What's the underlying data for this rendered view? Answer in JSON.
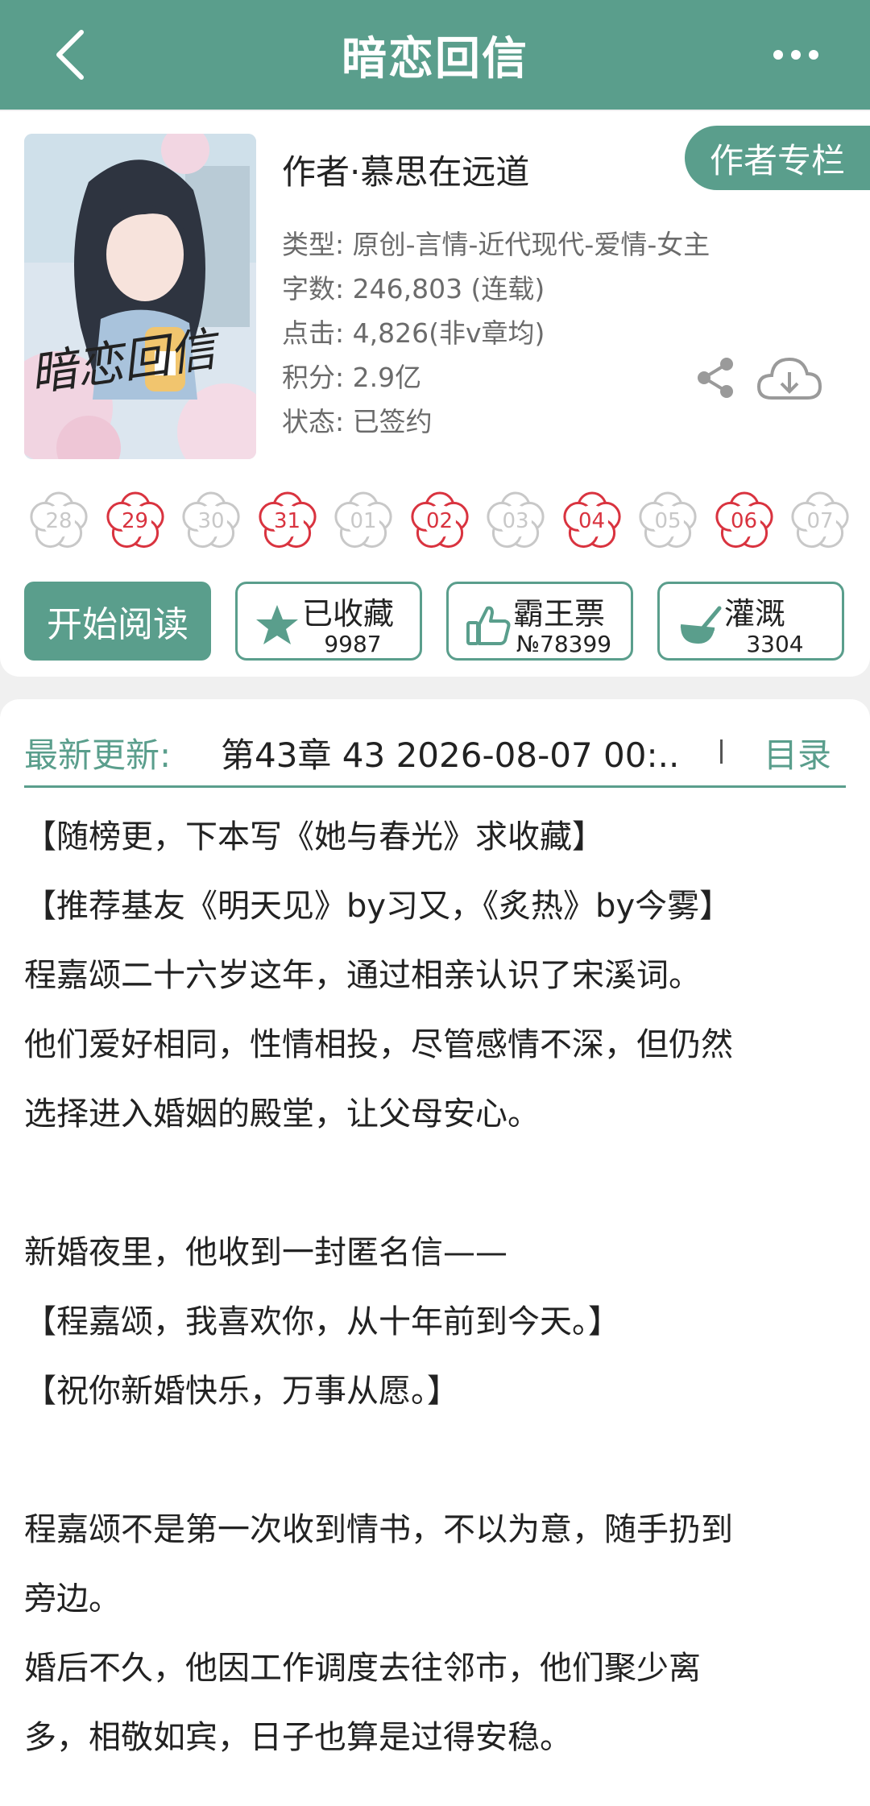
{
  "header": {
    "title": "暗恋回信"
  },
  "book": {
    "author": "作者·慕思在远道",
    "author_column_label": "作者专栏",
    "cover_title_art": "暗恋回信",
    "meta": [
      "类型: 原创-言情-近代现代-爱情-女主",
      "字数: 246,803 (连载)",
      "点击: 4,826(非v章均)",
      "积分: 2.9亿",
      "状态: 已签约"
    ]
  },
  "dates": [
    {
      "day": "28",
      "active": false
    },
    {
      "day": "29",
      "active": true
    },
    {
      "day": "30",
      "active": false
    },
    {
      "day": "31",
      "active": true
    },
    {
      "day": "01",
      "active": false
    },
    {
      "day": "02",
      "active": true
    },
    {
      "day": "03",
      "active": false
    },
    {
      "day": "04",
      "active": true
    },
    {
      "day": "05",
      "active": false
    },
    {
      "day": "06",
      "active": true
    },
    {
      "day": "07",
      "active": false
    }
  ],
  "actions": {
    "start_reading": "开始阅读",
    "favorite": {
      "label": "已收藏",
      "count": "9987"
    },
    "ticket": {
      "label": "霸王票",
      "count": "№78399"
    },
    "nutrient": {
      "label": "灌溉",
      "count": "3304"
    }
  },
  "update": {
    "label": "最新更新:",
    "text": "第43章  43  2026-08-07 00:..",
    "toc_label": "目录"
  },
  "intro": [
    "【随榜更，下本写《她与春光》求收藏】",
    "【推荐基友《明天见》by习又，《炙热》by今雾】",
    "程嘉颂二十六岁这年，通过相亲认识了宋溪词。",
    "他们爱好相同，性情相投，尽管感情不深，但仍然",
    "选择进入婚姻的殿堂，让父母安心。",
    "",
    "新婚夜里，他收到一封匿名信——",
    "【程嘉颂，我喜欢你，从十年前到今天。】",
    "【祝你新婚快乐，万事从愿。】",
    "",
    "程嘉颂不是第一次收到情书，不以为意，随手扔到",
    "旁边。",
    "婚后不久，他因工作调度去往邻市，他们聚少离",
    "多，相敬如宾，日子也算是过得安稳。"
  ],
  "colors": {
    "accent": "#5a9e8c",
    "active_date": "#d9333f",
    "inactive_date": "#c8c8c8"
  }
}
